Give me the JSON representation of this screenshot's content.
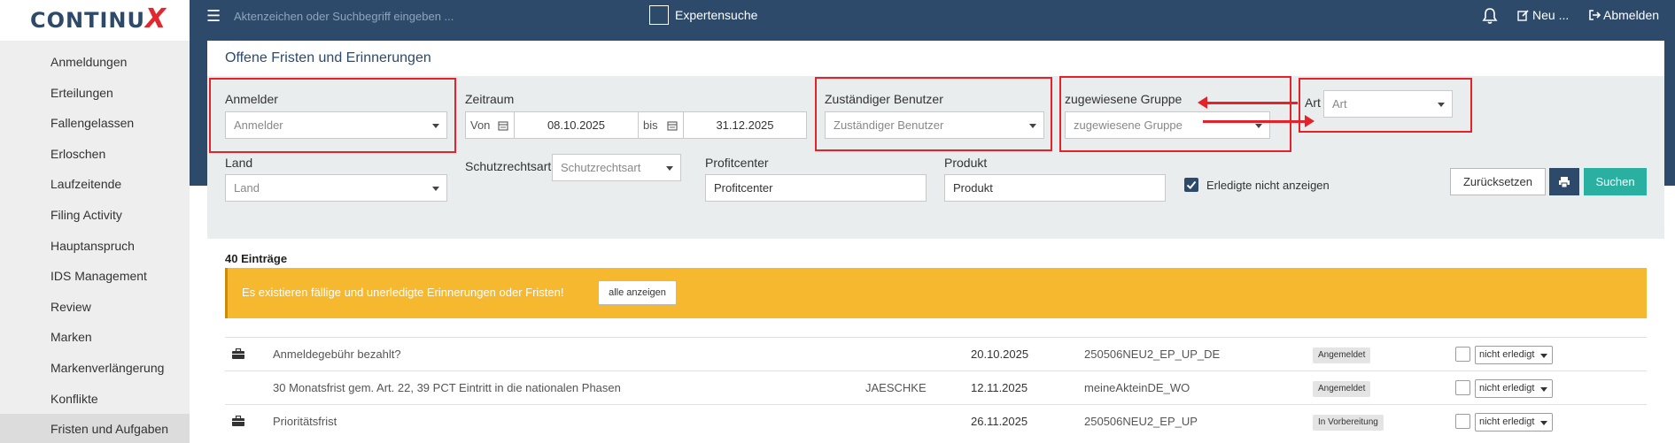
{
  "app": {
    "logo_text": "CONTINU",
    "logo_x": "X"
  },
  "topbar": {
    "search_placeholder": "Aktenzeichen oder Suchbegriff eingeben ...",
    "expert_label": "Expertensuche",
    "new_label": "Neu ...",
    "logout_label": "Abmelden"
  },
  "sidebar": {
    "items": [
      {
        "label": "Anmeldungen"
      },
      {
        "label": "Erteilungen"
      },
      {
        "label": "Fallengelassen"
      },
      {
        "label": "Erloschen"
      },
      {
        "label": "Laufzeitende"
      },
      {
        "label": "Filing Activity"
      },
      {
        "label": "Hauptanspruch"
      },
      {
        "label": "IDS Management"
      },
      {
        "label": "Review"
      },
      {
        "label": "Marken"
      },
      {
        "label": "Markenverlängerung"
      },
      {
        "label": "Konflikte"
      },
      {
        "label": "Fristen und Aufgaben"
      }
    ],
    "active_index": 12
  },
  "panel": {
    "title": "Offene Fristen und Erinnerungen"
  },
  "filters": {
    "anmelder": {
      "label": "Anmelder",
      "placeholder": "Anmelder"
    },
    "zeitraum": {
      "label": "Zeitraum",
      "von_label": "Von",
      "von_value": "08.10.2025",
      "bis_label": "bis",
      "bis_value": "31.12.2025"
    },
    "zustaendiger_benutzer": {
      "label": "Zuständiger Benutzer",
      "placeholder": "Zuständiger Benutzer"
    },
    "zugewiesene_gruppe": {
      "label": "zugewiesene Gruppe",
      "placeholder": "zugewiesene Gruppe"
    },
    "art": {
      "label": "Art",
      "placeholder": "Art"
    },
    "land": {
      "label": "Land",
      "placeholder": "Land"
    },
    "schutzrechtsart": {
      "label": "Schutzrechtsart",
      "placeholder": "Schutzrechtsart"
    },
    "profitcenter": {
      "label": "Profitcenter",
      "placeholder": "Profitcenter"
    },
    "produkt": {
      "label": "Produkt",
      "placeholder": "Produkt"
    },
    "hide_done_label": "Erledigte nicht anzeigen",
    "hide_done_checked": true,
    "reset_label": "Zurücksetzen",
    "search_label": "Suchen"
  },
  "results": {
    "count_label": "40 Einträge",
    "alert_text": "Es existieren fällige und unerledigte Erinnerungen oder Fristen!",
    "alert_button": "alle anzeigen",
    "rows": [
      {
        "has_icon": true,
        "title": "Anmeldegebühr bezahlt?",
        "user": "",
        "date": "20.10.2025",
        "file": "250506NEU2_EP_UP_DE",
        "state": "Angemeldet",
        "status": "nicht erledigt"
      },
      {
        "has_icon": false,
        "title": "30 Monatsfrist gem. Art. 22, 39 PCT Eintritt in die nationalen Phasen",
        "user": "JAESCHKE",
        "date": "12.11.2025",
        "file": "meineAkteinDE_WO",
        "state": "Angemeldet",
        "status": "nicht erledigt"
      },
      {
        "has_icon": true,
        "title": "Prioritätsfrist",
        "user": "",
        "date": "26.11.2025",
        "file": "250506NEU2_EP_UP",
        "state": "In Vorbereitung",
        "status": "nicht erledigt"
      }
    ]
  },
  "colors": {
    "navy": "#2d4a6a",
    "teal": "#2ab0a0",
    "alert": "#f6b82f",
    "annotation_red": "#e52229"
  }
}
